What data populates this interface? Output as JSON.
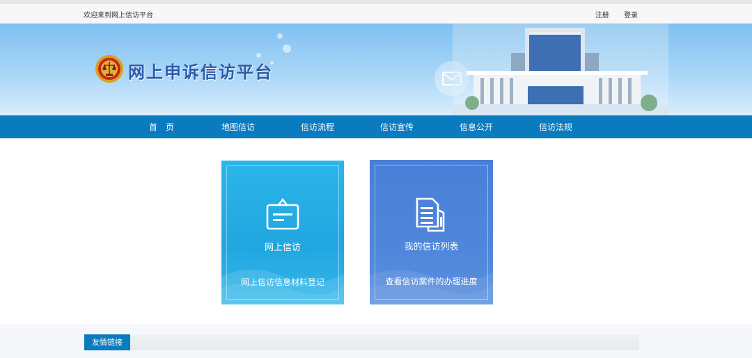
{
  "topbar": {
    "welcome": "欢迎来到网上信访平台",
    "register": "注册",
    "login": "登录"
  },
  "header": {
    "site_title": "网上申诉信访平台",
    "logo_icon": "court-emblem-icon",
    "mail_icon": "envelope-icon"
  },
  "nav": {
    "items": [
      {
        "label": "首　页"
      },
      {
        "label": "地图信访"
      },
      {
        "label": "信访流程"
      },
      {
        "label": "信访宣传"
      },
      {
        "label": "信息公开"
      },
      {
        "label": "信访法规"
      }
    ]
  },
  "cards": [
    {
      "title": "网上信访",
      "desc": "网上信访信息材料登记",
      "icon": "board-sign-icon"
    },
    {
      "title": "我的信访列表",
      "desc": "查看信访案件的办理进度",
      "icon": "documents-icon"
    }
  ],
  "footer": {
    "friend_links": "友情链接"
  },
  "colors": {
    "nav_blue": "#0a7bbf",
    "card_cyan": "#21a6e0",
    "card_blue": "#4f86da"
  }
}
